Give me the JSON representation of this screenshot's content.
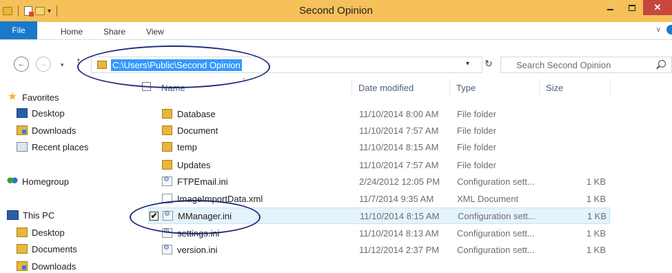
{
  "window": {
    "title": "Second Opinion"
  },
  "ribbon": {
    "tabs": [
      "File",
      "Home",
      "Share",
      "View"
    ]
  },
  "address": {
    "path": "C:\\Users\\Public\\Second Opinion",
    "search_placeholder": "Search Second Opinion"
  },
  "nav": {
    "items": [
      {
        "label": "Favorites",
        "icon": "star-icon"
      },
      {
        "label": "Desktop",
        "icon": "desktop-icon"
      },
      {
        "label": "Downloads",
        "icon": "downloads-folder-icon"
      },
      {
        "label": "Recent places",
        "icon": "recent-places-icon"
      },
      {
        "label": "Homegroup",
        "icon": "homegroup-icon"
      },
      {
        "label": "This PC",
        "icon": "computer-icon"
      },
      {
        "label": "Desktop",
        "icon": "folder-icon"
      },
      {
        "label": "Documents",
        "icon": "documents-folder-icon"
      },
      {
        "label": "Downloads",
        "icon": "downloads-folder-icon"
      }
    ]
  },
  "columns": {
    "name": "Name",
    "date": "Date modified",
    "type": "Type",
    "size": "Size"
  },
  "files": [
    {
      "name": "Database",
      "date": "11/10/2014 8:00 AM",
      "type": "File folder",
      "size": "",
      "icon": "folder-icon"
    },
    {
      "name": "Document",
      "date": "11/10/2014 7:57 AM",
      "type": "File folder",
      "size": "",
      "icon": "folder-icon"
    },
    {
      "name": "temp",
      "date": "11/10/2014 8:15 AM",
      "type": "File folder",
      "size": "",
      "icon": "folder-icon"
    },
    {
      "name": "Updates",
      "date": "11/10/2014 7:57 AM",
      "type": "File folder",
      "size": "",
      "icon": "folder-icon"
    },
    {
      "name": "FTPEmail.ini",
      "date": "2/24/2012 12:05 PM",
      "type": "Configuration sett...",
      "size": "1 KB",
      "icon": "ini-file-icon"
    },
    {
      "name": "ImageImportData.xml",
      "date": "11/7/2014 9:35 AM",
      "type": "XML Document",
      "size": "1 KB",
      "icon": "xml-file-icon"
    },
    {
      "name": "MManager.ini",
      "date": "11/10/2014 8:15 AM",
      "type": "Configuration sett...",
      "size": "1 KB",
      "icon": "ini-file-icon",
      "checked": "✔"
    },
    {
      "name": "settings.ini",
      "date": "11/10/2014 8:13 AM",
      "type": "Configuration sett...",
      "size": "1 KB",
      "icon": "ini-file-icon"
    },
    {
      "name": "version.ini",
      "date": "11/12/2014 2:37 PM",
      "type": "Configuration sett...",
      "size": "1 KB",
      "icon": "ini-file-icon"
    }
  ],
  "colors": {
    "titlebar": "#f6c05a",
    "file_tab": "#1979ca",
    "selection": "#3399ff",
    "annotation": "#1f2a7a"
  }
}
